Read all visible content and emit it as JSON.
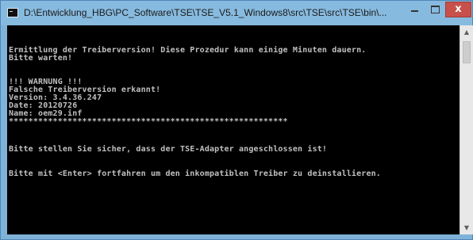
{
  "window": {
    "title": "D:\\Entwicklung_HBG\\PC_Software\\TSE\\TSE_V5.1_Windows8\\src\\TSE\\src\\TSE\\bin\\..."
  },
  "caption_buttons": {
    "close_label": "x"
  },
  "console": {
    "lines": [
      "Ermittlung der Treiberversion! Diese Prozedur kann einige Minuten dauern.",
      "Bitte warten!",
      "!!! WARNUNG !!!",
      "Falsche Treiberversion erkannt!",
      "Version: 3.4.36.247",
      "Date: 20120726",
      "Name: oem29.inf",
      "*********************************************************",
      "Bitte stellen Sie sicher, dass der TSE-Adapter angeschlossen ist!",
      "Bitte mit <Enter> fortfahren um den inkompatiblen Treiber zu deinstallieren."
    ]
  },
  "scrollbar": {
    "up_arrow": "▲",
    "down_arrow": "▼"
  },
  "colors": {
    "title_bar": "#87badf",
    "console_background": "#000000",
    "console_text": "#c0c0c0",
    "close_button": "#c7504b"
  },
  "icons": {
    "app": "console-app-icon",
    "minimize": "minimize-icon",
    "maximize": "maximize-icon",
    "close": "close-icon"
  }
}
